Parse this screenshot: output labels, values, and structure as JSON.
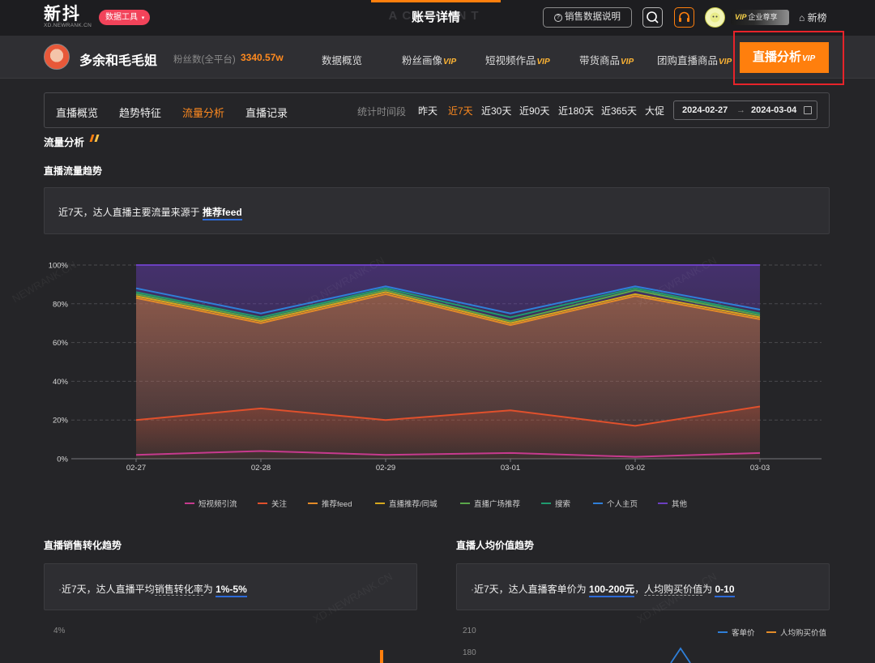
{
  "header": {
    "logo_text": "新抖",
    "logo_sub": "XD.NEWRANK.CN",
    "tool_badge": "数据工具",
    "center_title": "账号详情",
    "center_ghost": "ACCOUNT",
    "sales_help": "销售数据说明",
    "vip_brand": "VIP",
    "vip_label": "企业尊享",
    "new_rank": "新榜"
  },
  "account": {
    "name": "多余和毛毛姐",
    "fans_label": "粉丝数(全平台)",
    "fans_value": "3340.57w",
    "nav": [
      {
        "label": "数据概览",
        "vip": ""
      },
      {
        "label": "粉丝画像",
        "vip": "VIP"
      },
      {
        "label": "短视频作品",
        "vip": "VIP"
      },
      {
        "label": "带货商品",
        "vip": "VIP"
      },
      {
        "label": "团购直播商品",
        "vip": "VIP"
      }
    ],
    "active_tab": {
      "label": "直播分析",
      "vip": "VIP"
    }
  },
  "subtabs": {
    "items": [
      "直播概览",
      "趋势特征",
      "流量分析",
      "直播记录"
    ],
    "active": "流量分析",
    "time_label": "统计时间段",
    "time_options": [
      "昨天",
      "近7天",
      "近30天",
      "近90天",
      "近180天",
      "近365天",
      "大促"
    ],
    "time_active": "近7天",
    "date_start": "2024-02-27",
    "date_arrow": "→",
    "date_end": "2024-03-04"
  },
  "section": {
    "title": "流量分析"
  },
  "traffic_chart": {
    "title": "直播流量趋势",
    "summary_prefix": "近7天，达人直播主要流量来源于",
    "summary_value": "推荐feed"
  },
  "chart_data": {
    "type": "area",
    "x": [
      "02-27",
      "02-28",
      "02-29",
      "03-01",
      "03-02",
      "03-03"
    ],
    "y_ticks": [
      "0%",
      "20%",
      "40%",
      "60%",
      "80%",
      "100%"
    ],
    "ylim": [
      0,
      100
    ],
    "series": [
      {
        "name": "短视频引流",
        "color": "#c63a8e",
        "values": [
          2,
          4,
          2,
          3,
          1,
          3
        ]
      },
      {
        "name": "关注",
        "color": "#e0502c",
        "values": [
          20,
          26,
          20,
          25,
          17,
          27
        ]
      },
      {
        "name": "推荐feed",
        "color": "#e48b28",
        "values": [
          83,
          70,
          85,
          69,
          84,
          72
        ]
      },
      {
        "name": "直播推荐/同城",
        "color": "#d6a81e",
        "values": [
          84,
          71,
          86,
          70,
          85,
          73
        ]
      },
      {
        "name": "直播广场推荐",
        "color": "#5aa64a",
        "values": [
          85,
          72,
          87,
          71,
          87,
          74
        ]
      },
      {
        "name": "搜索",
        "color": "#1f9a6e",
        "values": [
          86,
          73,
          88,
          73,
          88,
          75
        ]
      },
      {
        "name": "个人主页",
        "color": "#2f7fd8",
        "values": [
          88,
          75,
          89,
          75,
          89,
          77
        ]
      },
      {
        "name": "其他",
        "color": "#6b3fc0",
        "values": [
          100,
          100,
          100,
          100,
          100,
          100
        ]
      }
    ],
    "grid": true,
    "legend": "bottom"
  },
  "conversion_chart": {
    "title": "直播销售转化趋势",
    "summary_prefix": "近7天，达人直播平均",
    "summary_underlined": "销售转化率",
    "summary_mid": "为",
    "summary_value": "1%-5%",
    "y_top_label": "4%"
  },
  "avg_value_chart": {
    "title": "直播人均价值趋势",
    "summary_prefix": "近7天，达人直播客单价为",
    "summary_value1": "100-200元",
    "summary_sep": "，",
    "summary_underlined": "人均购买价值",
    "summary_mid": "为",
    "summary_value2": "0-10",
    "y_labels": [
      "210",
      "180"
    ],
    "legend": [
      {
        "name": "客单价",
        "color": "#2f7fd8"
      },
      {
        "name": "人均购买价值",
        "color": "#e48b28"
      }
    ]
  },
  "colors": {
    "accent": "#ff7f0d",
    "highlight_border": "#e7232a",
    "background": "#252528"
  }
}
